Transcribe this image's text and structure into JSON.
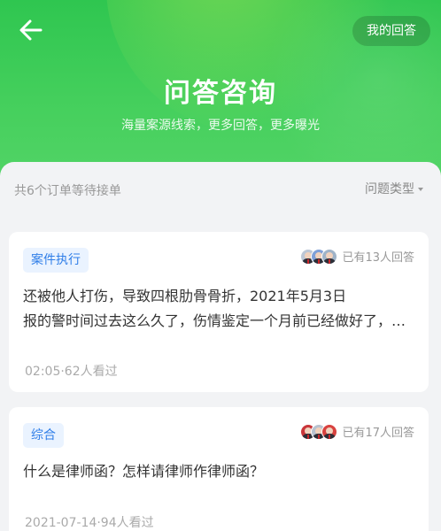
{
  "header": {
    "title": "问答咨询",
    "subtitle": "海量案源线索，更多回答，更多曝光",
    "my_answer_label": "我的回答"
  },
  "list": {
    "order_count_text": "共6个订单等待接单",
    "filter_label": "问题类型"
  },
  "questions": [
    {
      "tag": "案件执行",
      "reply_text": "已有13人回答",
      "line1": "还被他人打伤，导致四根肋骨骨折，2021年5月3日",
      "line2": "报的警时间过去这么久了，伤情鉴定一个月前已经做好了，派出所说伤情鉴定结果为轻伤",
      "meta": "02:05·62人看过"
    },
    {
      "tag": "综合",
      "reply_text": "已有17人回答",
      "line1": "什么是律师函？怎样请律师作律师函？",
      "meta": "2021-07-14·94人看过"
    }
  ],
  "colors": {
    "brand_green": "#2fc650",
    "tag_bg": "#eaf3ff",
    "tag_text": "#2f7ee8"
  }
}
